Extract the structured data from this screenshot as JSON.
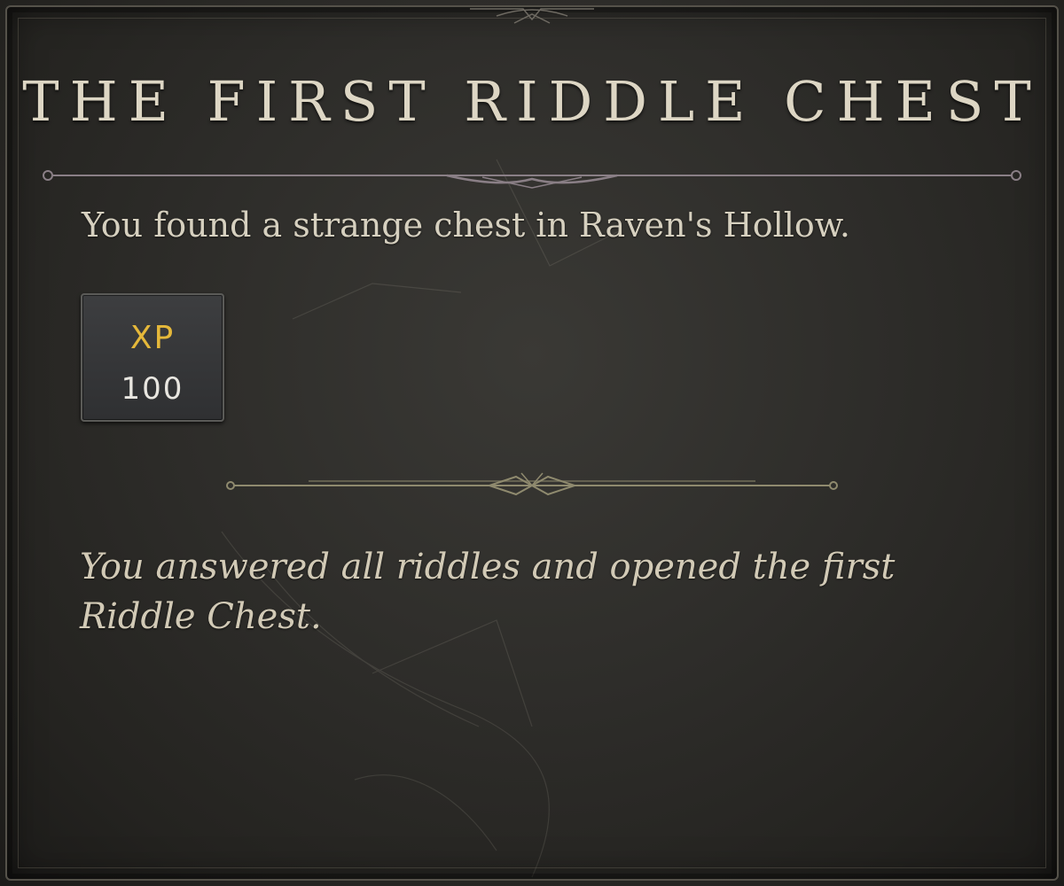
{
  "dialog": {
    "title": "THE FIRST RIDDLE CHEST",
    "intro": "You found a strange chest in Raven's Hollow.",
    "reward": {
      "label": "XP",
      "value": "100",
      "icon": "xp-reward-icon"
    },
    "outcome": "You answered all riddles and opened the first Riddle Chest."
  },
  "colors": {
    "background": "#2e2d2a",
    "title": "#ddd6c4",
    "text": "#d6d0bf",
    "xp_accent": "#e5b83a",
    "ornament": "#8a7f86"
  }
}
